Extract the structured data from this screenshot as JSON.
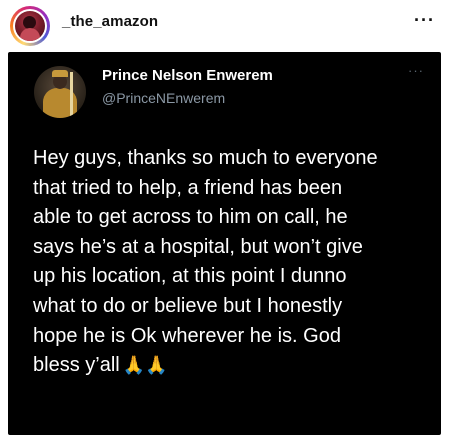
{
  "instagram": {
    "username": "_the_amazon",
    "more_icon": "more-horizontal-icon",
    "more_label": "···"
  },
  "tweet": {
    "display_name": "Prince Nelson Enwerem",
    "handle": "@PrinceNEnwerem",
    "more_label": "···",
    "text_lines": [
      "Hey guys, thanks so much to everyone",
      "that tried to help, a friend has been",
      "able to get across to him on call, he",
      "says he’s at a hospital, but won’t give",
      "up his location, at this point I dunno",
      "what to do or believe but I honestly",
      "hope he is Ok wherever he is. God",
      "bless y’all"
    ],
    "emoji": "🙏🙏",
    "emoji_icon": "praying-hands-icon"
  },
  "colors": {
    "tweet_background": "#000000",
    "tweet_text": "#ffffff",
    "handle_text": "#8b98a5"
  }
}
